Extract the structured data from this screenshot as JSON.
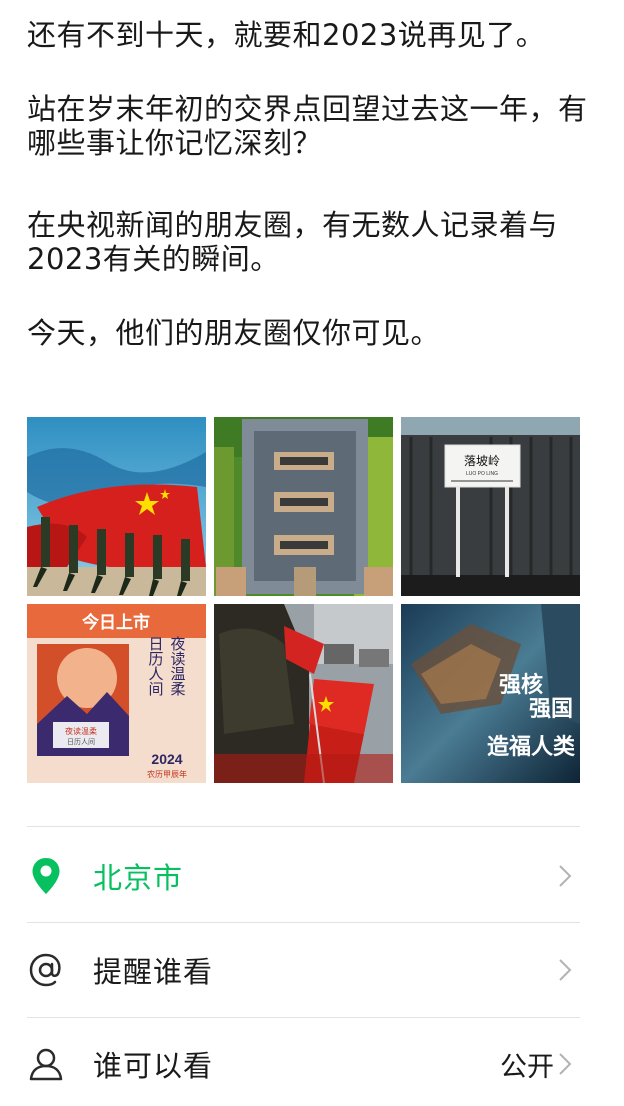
{
  "post": {
    "paragraphs": [
      "还有不到十天，就要和2023说再见了。",
      "站在岁末年初的交界点回望过去这一年，有哪些事让你记忆深刻？",
      "在央视新闻的朋友圈，有无数人记录着与2023有关的瞬间。",
      "今天，他们的朋友圈仅你可见。"
    ]
  },
  "images": [
    {
      "name": "honor-guard-flag-image"
    },
    {
      "name": "aerial-courtyard-image"
    },
    {
      "name": "train-station-image",
      "sign_text": "落坡岭",
      "sign_sub": "LUO PO LING"
    },
    {
      "name": "calendar-ad-image",
      "banner": "今日上市",
      "lines": [
        "夜读温柔",
        "日历人间"
      ],
      "box_text": "夜读温柔",
      "box_sub": "日历人间",
      "year": "2024",
      "footnote": "农历甲辰年"
    },
    {
      "name": "flags-street-image"
    },
    {
      "name": "scifi-poster-image",
      "title_lines": [
        "强核",
        "强国",
        "造福人类"
      ]
    }
  ],
  "options": {
    "location": {
      "label": "北京市",
      "icon": "location-pin-icon",
      "color": "#07c160"
    },
    "mention": {
      "label": "提醒谁看",
      "icon": "at-sign-icon"
    },
    "visibility": {
      "label": "谁可以看",
      "icon": "person-icon",
      "value": "公开"
    }
  }
}
